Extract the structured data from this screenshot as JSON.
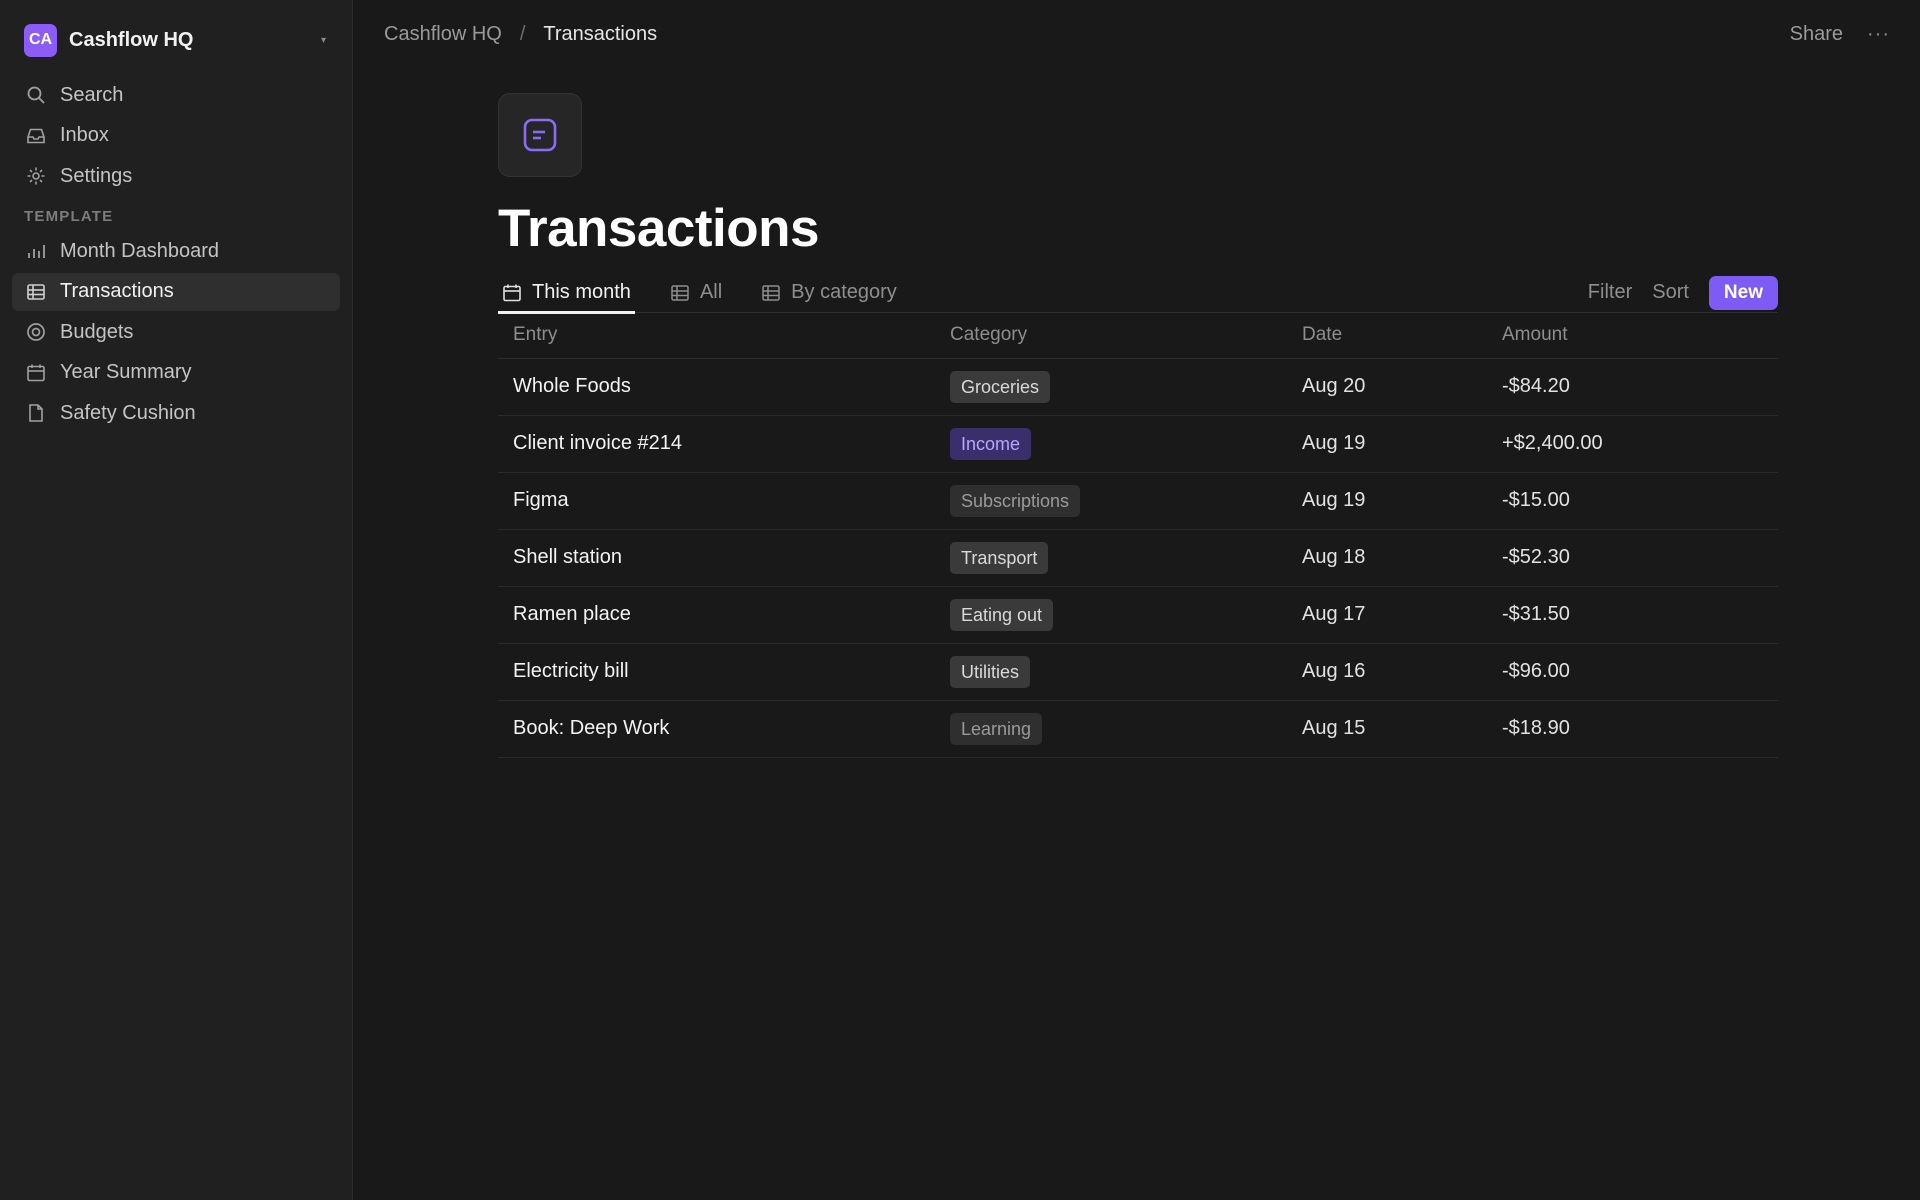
{
  "workspace": {
    "initials": "CA",
    "name": "Cashflow HQ"
  },
  "sidebar": {
    "top_items": [
      {
        "label": "Search",
        "icon": "search-icon"
      },
      {
        "label": "Inbox",
        "icon": "inbox-icon"
      },
      {
        "label": "Settings",
        "icon": "gear-icon"
      }
    ],
    "section_label": "TEMPLATE",
    "pages": [
      {
        "label": "Month Dashboard",
        "icon": "bar-chart-icon"
      },
      {
        "label": "Transactions",
        "icon": "table-icon",
        "active": true
      },
      {
        "label": "Budgets",
        "icon": "target-icon"
      },
      {
        "label": "Year Summary",
        "icon": "calendar-icon"
      },
      {
        "label": "Safety Cushion",
        "icon": "document-icon"
      }
    ]
  },
  "breadcrumb": {
    "root": "Cashflow HQ",
    "separator": "/",
    "current": "Transactions"
  },
  "topbar": {
    "share": "Share",
    "more": "···"
  },
  "page": {
    "title": "Transactions",
    "icon": "note-icon"
  },
  "tabs": [
    {
      "label": "This month",
      "icon": "calendar-icon",
      "active": true
    },
    {
      "label": "All",
      "icon": "table-icon"
    },
    {
      "label": "By category",
      "icon": "table-icon"
    }
  ],
  "actions": {
    "filter": "Filter",
    "sort": "Sort",
    "new": "New"
  },
  "table": {
    "columns": [
      "Entry",
      "Category",
      "Date",
      "Amount"
    ],
    "rows": [
      {
        "entry": "Whole Foods",
        "category": "Groceries",
        "date": "Aug 20",
        "amount": "-$84.20"
      },
      {
        "entry": "Client invoice #214",
        "category": "Income",
        "date": "Aug 19",
        "amount": "+$2,400.00"
      },
      {
        "entry": "Figma",
        "category": "Subscriptions",
        "date": "Aug 19",
        "amount": "-$15.00"
      },
      {
        "entry": "Shell station",
        "category": "Transport",
        "date": "Aug 18",
        "amount": "-$52.30"
      },
      {
        "entry": "Ramen place",
        "category": "Eating out",
        "date": "Aug 17",
        "amount": "-$31.50"
      },
      {
        "entry": "Electricity bill",
        "category": "Utilities",
        "date": "Aug 16",
        "amount": "-$96.00"
      },
      {
        "entry": "Book: Deep Work",
        "category": "Learning",
        "date": "Aug 15",
        "amount": "-$18.90"
      }
    ]
  },
  "colors": {
    "accent": "#7c5cf5",
    "background": "#191919",
    "sidebar": "#202020",
    "tags": {
      "Groceries": {
        "bg": "#3a3a3a",
        "fg": "#d9d9d9"
      },
      "Income": {
        "bg": "#3a2f6b",
        "fg": "#b9a6ff"
      },
      "Subscriptions": {
        "bg": "#2f2f2f",
        "fg": "#9a9a9a"
      },
      "Transport": {
        "bg": "#3a3a3a",
        "fg": "#d9d9d9"
      },
      "Eating out": {
        "bg": "#3a3a3a",
        "fg": "#d9d9d9"
      },
      "Utilities": {
        "bg": "#3a3a3a",
        "fg": "#d9d9d9"
      },
      "Learning": {
        "bg": "#2f2f2f",
        "fg": "#9a9a9a"
      }
    }
  }
}
